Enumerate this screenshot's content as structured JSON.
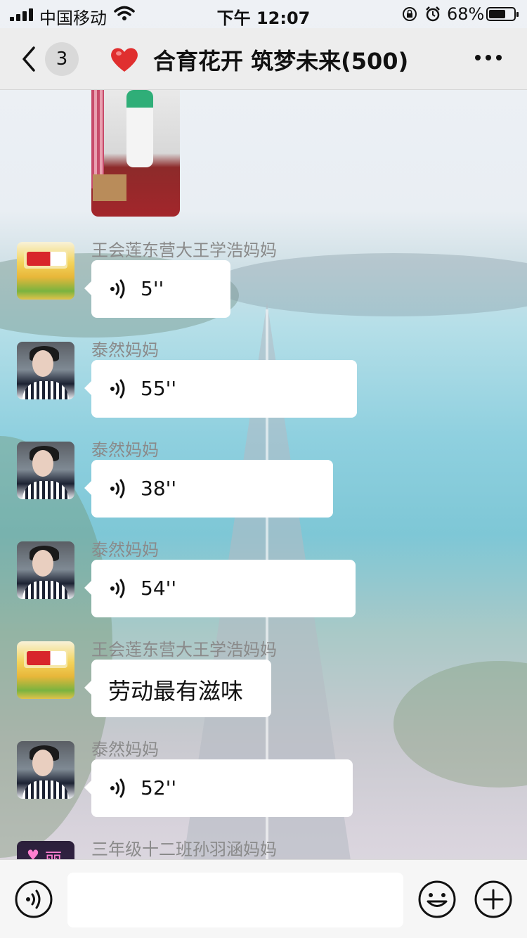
{
  "status_bar": {
    "carrier": "中国移动",
    "time": "下午 12:07",
    "battery_percent": "68%",
    "battery_level": 0.68
  },
  "header": {
    "unread_count": "3",
    "title": "合育花开 筑梦未来(500)",
    "icons": [
      "back-icon",
      "heart-icon",
      "more-icon"
    ]
  },
  "messages": [
    {
      "sender": "王会莲东营大王学浩妈妈",
      "type": "voice",
      "duration": "5''",
      "avatar": "product"
    },
    {
      "sender": "泰然妈妈",
      "type": "voice",
      "duration": "55''",
      "avatar": "woman"
    },
    {
      "sender": "泰然妈妈",
      "type": "voice",
      "duration": "38''",
      "avatar": "woman"
    },
    {
      "sender": "泰然妈妈",
      "type": "voice",
      "duration": "54''",
      "avatar": "woman"
    },
    {
      "sender": "王会莲东营大王学浩妈妈",
      "type": "text",
      "text": "劳动最有滋味",
      "avatar": "product"
    },
    {
      "sender": "泰然妈妈",
      "type": "voice",
      "duration": "52''",
      "avatar": "woman"
    },
    {
      "sender": "三年级十二班孙羽涵妈妈",
      "type": "partial",
      "avatar": "pink"
    }
  ],
  "input_bar": {
    "placeholder": "",
    "icons": [
      "voice-toggle-icon",
      "emoji-icon",
      "plus-icon"
    ]
  },
  "colors": {
    "nav_background": "#ededed",
    "bubble": "#ffffff",
    "sender_text": "#8a8a8a",
    "heart": "#e02f2f"
  }
}
